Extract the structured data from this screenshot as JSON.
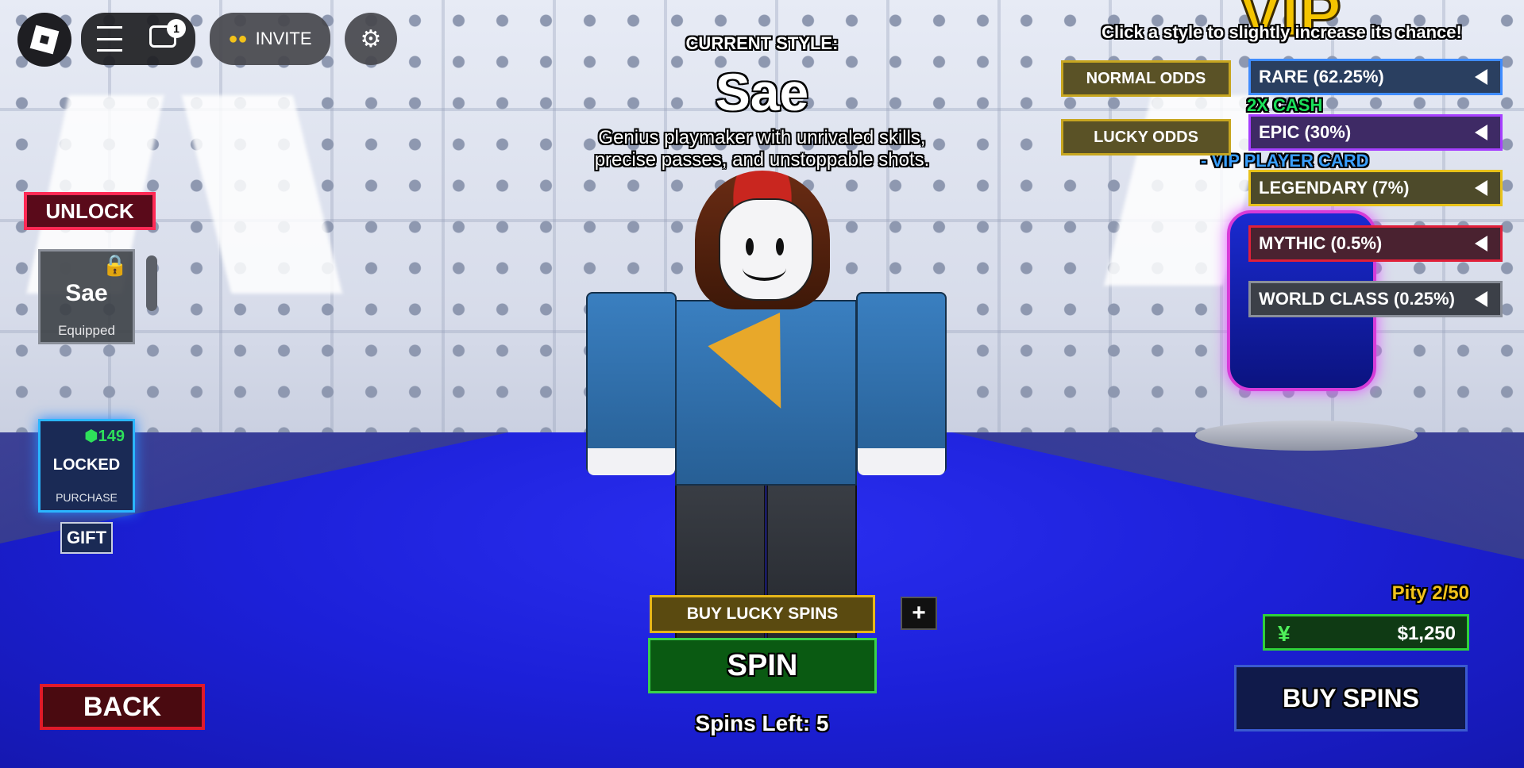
{
  "topbar": {
    "notification_count": "1",
    "invite_label": "INVITE"
  },
  "header": {
    "current_style_label": "CURRENT STYLE:",
    "style_name": "Sae",
    "description_line1": "Genius playmaker with unrivaled skills,",
    "description_line2": "precise passes, and unstoppable shots."
  },
  "hint": "Click a style to slightly increase its chance!",
  "odds_buttons": {
    "normal": "NORMAL ODDS",
    "lucky": "LUCKY ODDS"
  },
  "rarities": [
    {
      "label": "RARE (62.25%)",
      "bg": "#2a3f60",
      "border": "#3f8cff"
    },
    {
      "label": "EPIC (30%)",
      "bg": "#3e2a65",
      "border": "#a63fff"
    },
    {
      "label": "LEGENDARY (7%)",
      "bg": "#4d4a2a",
      "border": "#e8c21a"
    },
    {
      "label": "MYTHIC (0.5%)",
      "bg": "#4a2230",
      "border": "#e0203a"
    },
    {
      "label": "WORLD CLASS (0.25%)",
      "bg": "#3c4048",
      "border": "#8a8f99"
    }
  ],
  "background_signs": {
    "vip_title": "VIP",
    "cash_label": "2X CASH",
    "player_card_label": "- VIP PLAYER CARD"
  },
  "left_panel": {
    "unlock_label": "UNLOCK",
    "card_name": "Sae",
    "card_status": "Equipped",
    "locked_price": "149",
    "locked_label": "LOCKED",
    "purchase_label": "PURCHASE",
    "gift_label": "GIFT"
  },
  "bottom": {
    "buy_lucky_spins": "BUY LUCKY SPINS",
    "plus": "+",
    "spin_label": "SPIN",
    "spins_left": "Spins Left: 5",
    "back_label": "BACK",
    "pity": "Pity 2/50",
    "currency_symbol": "¥",
    "cash_amount": "$1,250",
    "buy_spins": "BUY SPINS"
  },
  "colors": {
    "spin_green": "#0a5a12",
    "spin_border": "#3ad14a",
    "back_red": "#e01a2a",
    "pity_gold": "#f2c21a",
    "cash_green": "#0f3a14",
    "buy_spins_navy": "#101a4a"
  }
}
